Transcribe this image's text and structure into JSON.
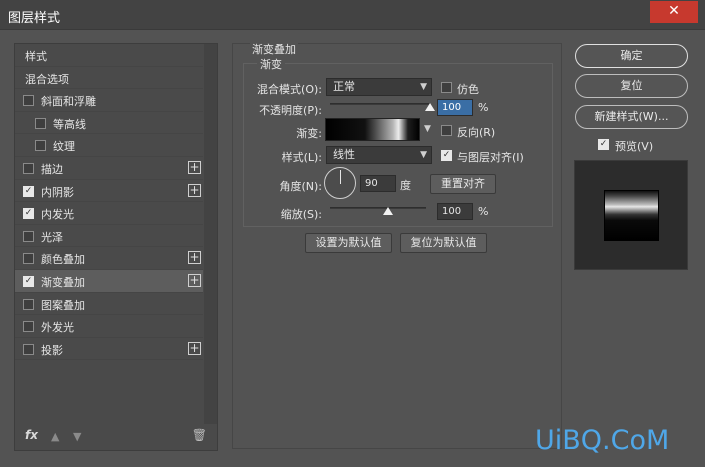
{
  "window": {
    "title": "图层样式",
    "close_label": "✕"
  },
  "left_list": {
    "items": [
      {
        "label": "样式",
        "checkbox": false,
        "checked": false,
        "plus": false,
        "indent": 0,
        "selected": false
      },
      {
        "label": "混合选项",
        "checkbox": false,
        "checked": false,
        "plus": false,
        "indent": 0,
        "selected": false
      },
      {
        "label": "斜面和浮雕",
        "checkbox": true,
        "checked": false,
        "plus": false,
        "indent": 0,
        "selected": false
      },
      {
        "label": "等高线",
        "checkbox": true,
        "checked": false,
        "plus": false,
        "indent": 1,
        "selected": false
      },
      {
        "label": "纹理",
        "checkbox": true,
        "checked": false,
        "plus": false,
        "indent": 1,
        "selected": false
      },
      {
        "label": "描边",
        "checkbox": true,
        "checked": false,
        "plus": true,
        "indent": 0,
        "selected": false
      },
      {
        "label": "内阴影",
        "checkbox": true,
        "checked": true,
        "plus": true,
        "indent": 0,
        "selected": false
      },
      {
        "label": "内发光",
        "checkbox": true,
        "checked": true,
        "plus": false,
        "indent": 0,
        "selected": false
      },
      {
        "label": "光泽",
        "checkbox": true,
        "checked": false,
        "plus": false,
        "indent": 0,
        "selected": false
      },
      {
        "label": "颜色叠加",
        "checkbox": true,
        "checked": false,
        "plus": true,
        "indent": 0,
        "selected": false
      },
      {
        "label": "渐变叠加",
        "checkbox": true,
        "checked": true,
        "plus": true,
        "indent": 0,
        "selected": true
      },
      {
        "label": "图案叠加",
        "checkbox": true,
        "checked": false,
        "plus": false,
        "indent": 0,
        "selected": false
      },
      {
        "label": "外发光",
        "checkbox": true,
        "checked": false,
        "plus": false,
        "indent": 0,
        "selected": false
      },
      {
        "label": "投影",
        "checkbox": true,
        "checked": false,
        "plus": true,
        "indent": 0,
        "selected": false
      }
    ],
    "footer": {
      "fx": "fx",
      "up_icon": "▲",
      "down_icon": "▼",
      "trash_icon": "🗑"
    }
  },
  "gradient_overlay": {
    "section_title": "渐变叠加",
    "group_title": "渐变",
    "blend_mode": {
      "label": "混合模式(O):",
      "value": "正常"
    },
    "dither": {
      "label": "仿色",
      "checked": false
    },
    "opacity": {
      "label": "不透明度(P):",
      "value": "100",
      "unit": "%",
      "percent": 100
    },
    "gradient": {
      "label": "渐变:"
    },
    "reverse": {
      "label": "反向(R)",
      "checked": false
    },
    "style": {
      "label": "样式(L):",
      "value": "线性"
    },
    "align_with_layer": {
      "label": "与图层对齐(I)",
      "checked": true
    },
    "angle": {
      "label": "角度(N):",
      "value": "90",
      "unit": "度"
    },
    "reset_alignment": "重置对齐",
    "scale": {
      "label": "缩放(S):",
      "value": "100",
      "unit": "%",
      "percent": 100
    },
    "make_default": "设置为默认值",
    "reset_default": "复位为默认值"
  },
  "right_panel": {
    "ok": "确定",
    "reset": "复位",
    "new_style": "新建样式(W)...",
    "preview": {
      "label": "预览(V)",
      "checked": true
    }
  },
  "watermark": "UiBQ.CoM",
  "colors": {
    "background": "#535353",
    "close_button": "#c7392e",
    "focus": "#3a6ea5",
    "watermark": "#4fa7e8"
  }
}
